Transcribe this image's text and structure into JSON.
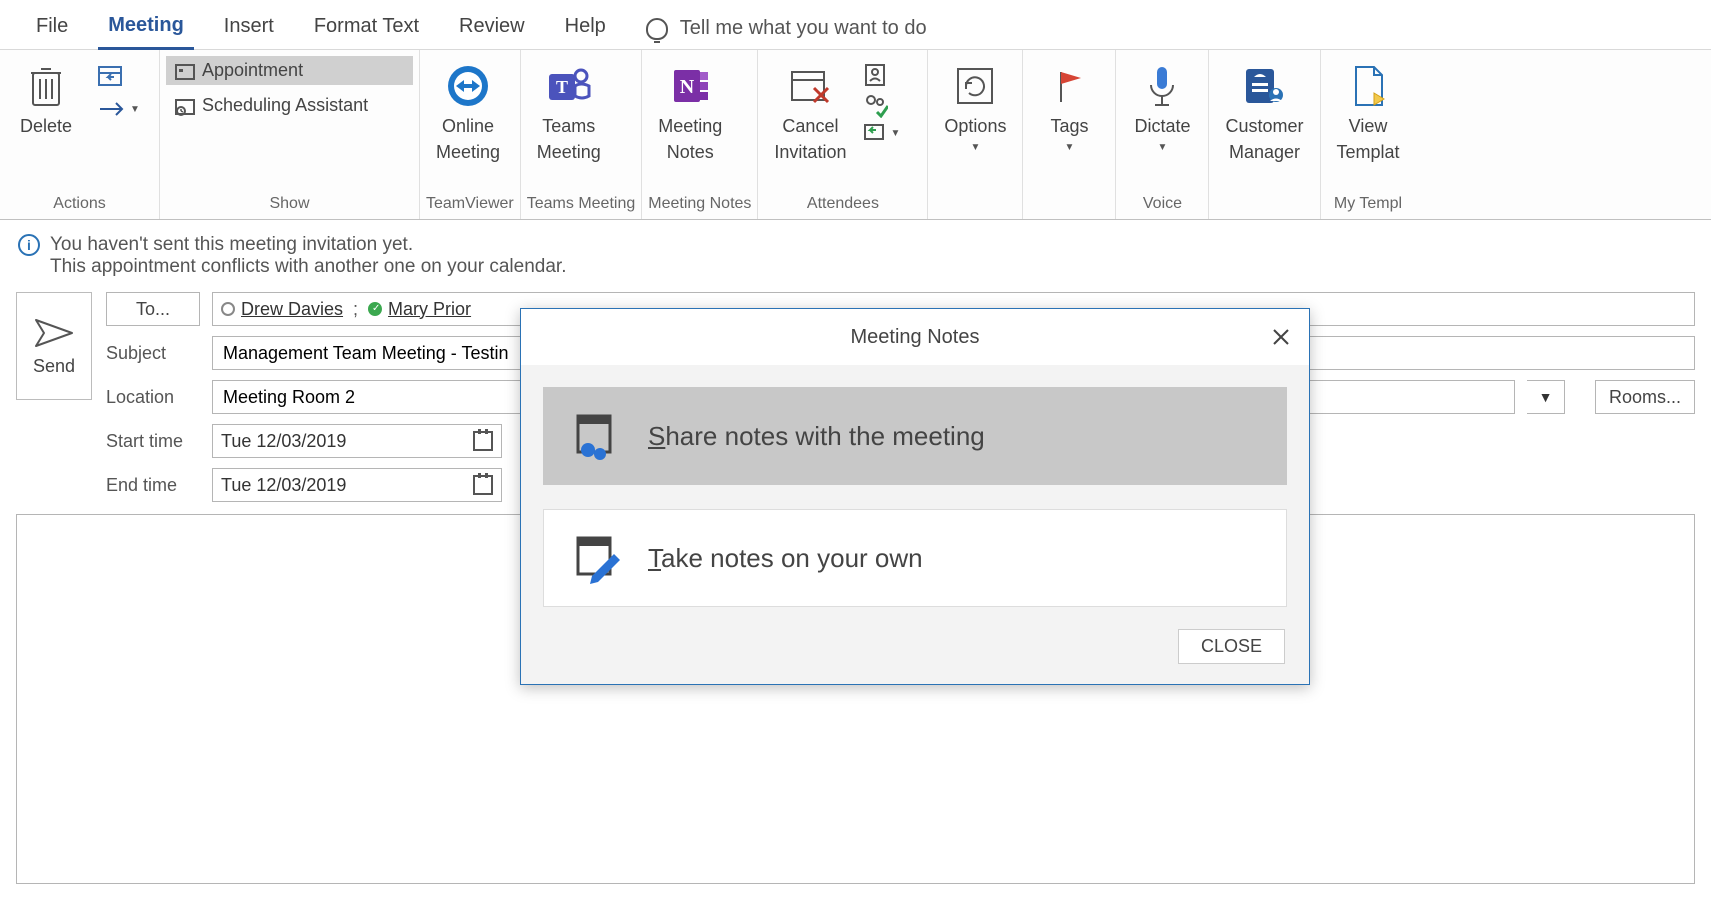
{
  "menu": {
    "file": "File",
    "meeting": "Meeting",
    "insert": "Insert",
    "format_text": "Format Text",
    "review": "Review",
    "help": "Help",
    "tellme": "Tell me what you want to do"
  },
  "ribbon": {
    "actions": {
      "delete": "Delete",
      "group": "Actions"
    },
    "show": {
      "appointment": "Appointment",
      "scheduling": "Scheduling Assistant",
      "group": "Show"
    },
    "teamviewer": {
      "label_line1": "Online",
      "label_line2": "Meeting",
      "group": "TeamViewer"
    },
    "teams": {
      "label_line1": "Teams",
      "label_line2": "Meeting",
      "group": "Teams Meeting"
    },
    "meetingnotes": {
      "label_line1": "Meeting",
      "label_line2": "Notes",
      "group": "Meeting Notes"
    },
    "attendees": {
      "cancel_line1": "Cancel",
      "cancel_line2": "Invitation",
      "group": "Attendees"
    },
    "options": {
      "label": "Options"
    },
    "tags": {
      "label": "Tags"
    },
    "voice": {
      "label": "Dictate",
      "group": "Voice"
    },
    "customer": {
      "label_line1": "Customer",
      "label_line2": "Manager"
    },
    "templates": {
      "label_line1": "View",
      "label_line2": "Templat",
      "group": "My Templ"
    }
  },
  "info": {
    "line1": "You haven't sent this meeting invitation yet.",
    "line2": "This appointment conflicts with another one on your calendar."
  },
  "form": {
    "send": "Send",
    "to_button": "To...",
    "recipients": [
      {
        "name": "Drew Davies",
        "status": "open"
      },
      {
        "name": "Mary Prior",
        "status": "green"
      }
    ],
    "subject_label": "Subject",
    "subject_value": "Management Team Meeting - Testin",
    "location_label": "Location",
    "location_value": "Meeting Room 2",
    "rooms": "Rooms...",
    "start_label": "Start time",
    "start_value": "Tue 12/03/2019",
    "end_label": "End time",
    "end_value": "Tue 12/03/2019"
  },
  "dialog": {
    "title": "Meeting Notes",
    "opt1_pre": "S",
    "opt1_rest": "hare notes with the meeting",
    "opt2_pre": "T",
    "opt2_rest": "ake notes on your own",
    "close": "CLOSE"
  }
}
